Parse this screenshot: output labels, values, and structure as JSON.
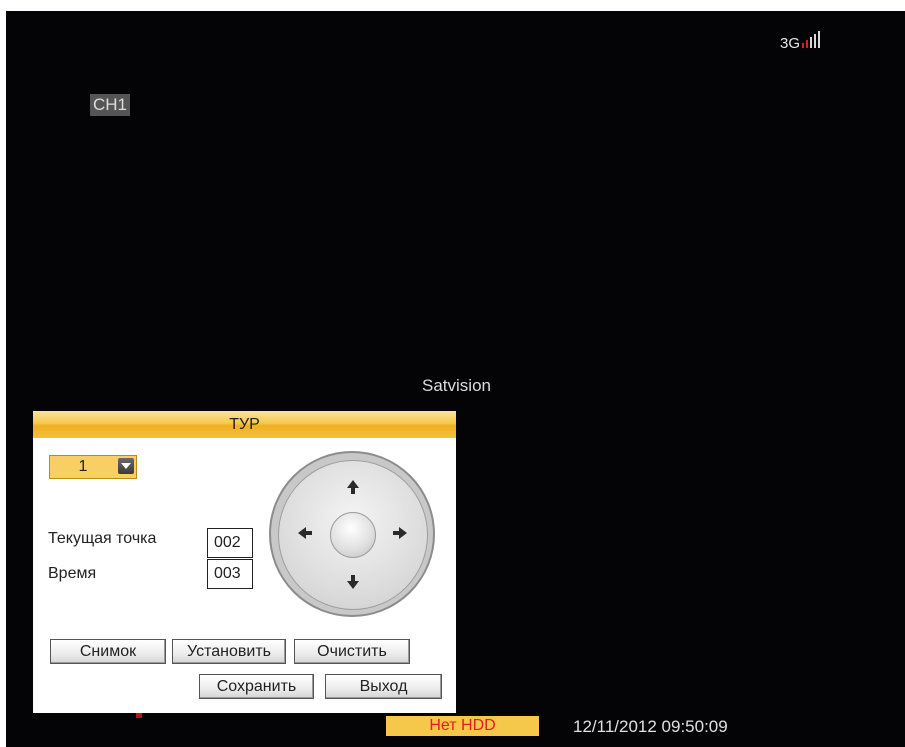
{
  "screen": {
    "channel_label": "CH1",
    "network_label": "3G",
    "watermark": "Satvision"
  },
  "dialog": {
    "title": "ТУР",
    "tour_select_value": "1",
    "current_point_label": "Текущая точка",
    "current_point_value": "002",
    "time_label": "Время",
    "time_value": "003",
    "buttons": {
      "snapshot": "Снимок",
      "set": "Установить",
      "clear": "Очистить",
      "save": "Сохранить",
      "exit": "Выход"
    },
    "ptz_icons": [
      "arrow-up-icon",
      "arrow-down-icon",
      "arrow-left-icon",
      "arrow-right-icon"
    ]
  },
  "status_bar": {
    "hdd_status": "Нет HDD",
    "datetime": "12/11/2012 09:50:09"
  },
  "colors": {
    "accent_yellow": "#f6c94e",
    "alert_red": "#e02020",
    "background": "#040305"
  }
}
